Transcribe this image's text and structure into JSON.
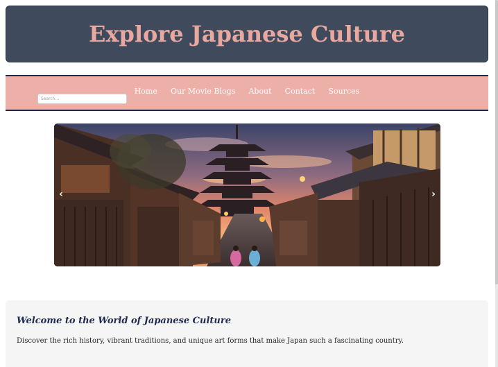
{
  "header": {
    "title": "Explore Japanese Culture"
  },
  "nav": {
    "items": [
      {
        "label": "Home"
      },
      {
        "label": "Our Movie Blogs"
      },
      {
        "label": "About"
      },
      {
        "label": "Contact"
      },
      {
        "label": "Sources"
      }
    ],
    "search_placeholder": "Search..."
  },
  "carousel": {
    "prev_icon": "chevron-left-icon",
    "next_icon": "chevron-right-icon",
    "prev_glyph": "‹",
    "next_glyph": "›",
    "image_subject": "Kyoto street with five-story pagoda at sunset"
  },
  "welcome": {
    "heading": "Welcome to the World of Japanese Culture",
    "text": "Discover the rich history, vibrant traditions, and unique art forms that make Japan such a fascinating country."
  },
  "colors": {
    "header_bg": "#3f4a5c",
    "header_text": "#e8a8a0",
    "nav_bg": "#ecb0a8",
    "nav_border": "#20284a",
    "welcome_bg": "#f5f5f5",
    "welcome_heading": "#1f2a4f"
  }
}
